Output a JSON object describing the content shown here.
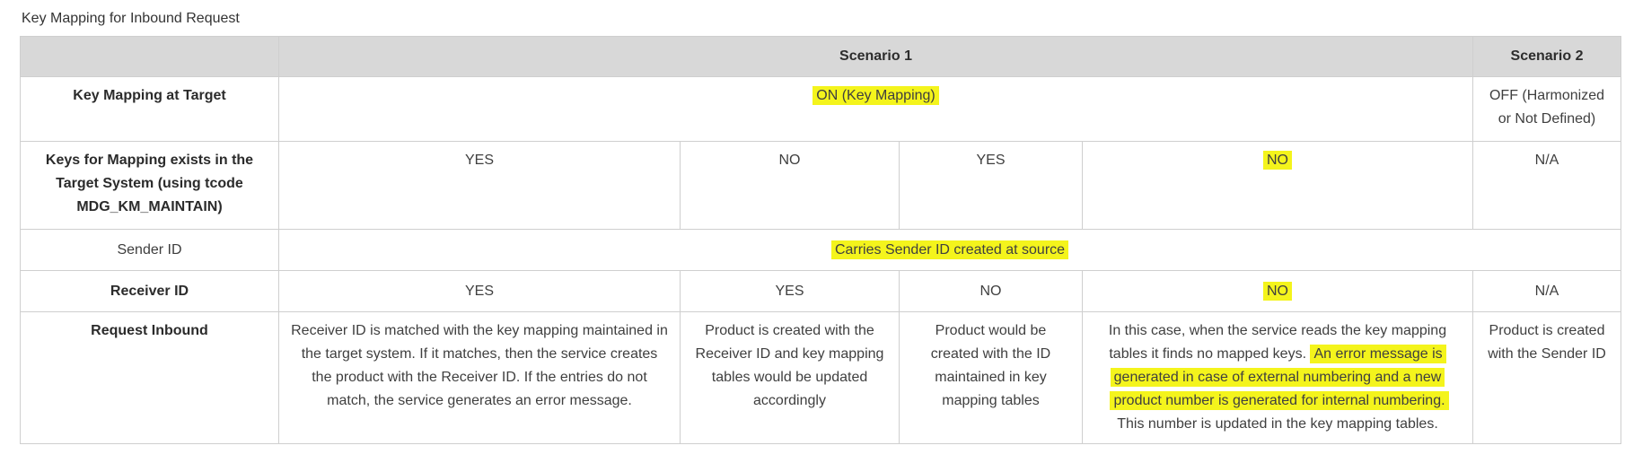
{
  "caption": "Key Mapping for Inbound Request",
  "header": {
    "col0": "",
    "scenario1": "Scenario 1",
    "scenario2": "Scenario 2"
  },
  "rows": {
    "key_mapping_at_target": {
      "label": "Key Mapping at Target",
      "scenario1": "ON (Key Mapping)",
      "scenario2": "OFF (Harmonized or Not Defined)"
    },
    "keys_exist": {
      "label": "Keys for Mapping exists in the Target System (using tcode MDG_KM_MAINTAIN)",
      "c1": "YES",
      "c2": "NO",
      "c3": "YES",
      "c4": "NO",
      "scenario2": "N/A"
    },
    "sender_id": {
      "label": "Sender ID",
      "scenario": "Carries Sender ID created at source"
    },
    "receiver_id": {
      "label": "Receiver ID",
      "c1": "YES",
      "c2": "YES",
      "c3": "NO",
      "c4": "NO",
      "scenario2": "N/A"
    },
    "request_inbound": {
      "label": "Request Inbound",
      "c1": "Receiver ID is matched with the key mapping maintained in the target system. If it matches, then the service creates the product with the Receiver ID. If the entries do not match, the service generates an error message.",
      "c2": "Product is created with the Receiver ID and key mapping tables would be updated accordingly",
      "c3": "Product would be created with the ID maintained in key mapping tables",
      "c4_part1": "In this case, when the service reads the key mapping tables it finds no mapped keys.",
      "c4_highlight": "An error message is generated in case of external numbering and a new product number is generated for internal numbering.",
      "c4_part2": "This number is updated in the key mapping tables.",
      "scenario2": "Product is created with the Sender ID"
    }
  },
  "colors": {
    "header_bg": "#d8d8d8",
    "highlight": "#f4f41c",
    "border": "#cfcfcf"
  }
}
